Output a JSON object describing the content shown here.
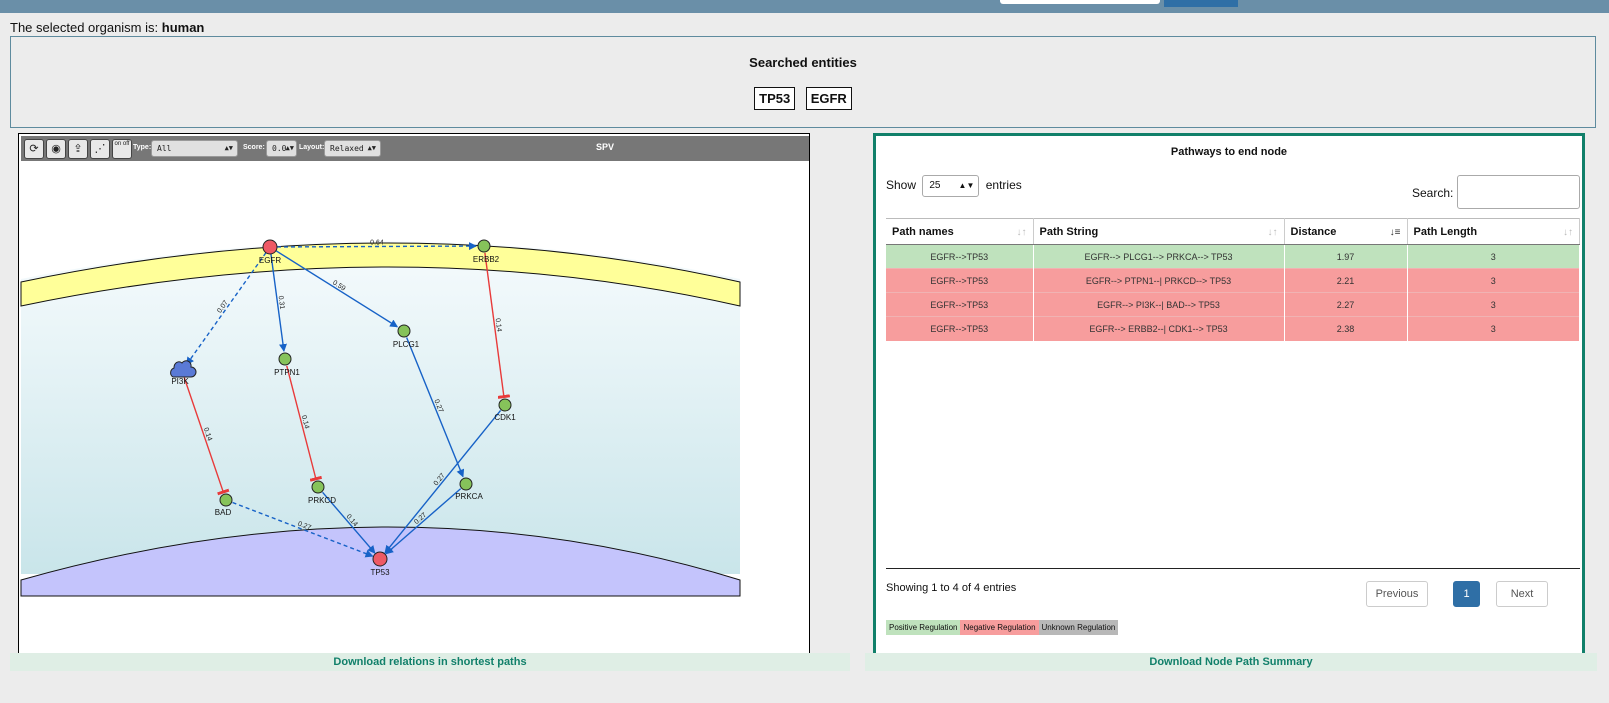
{
  "organism": {
    "prefix": "The selected organism is:",
    "name": "human"
  },
  "searched": {
    "title": "Searched entities",
    "entities": [
      "TP53",
      "EGFR"
    ]
  },
  "toolbar": {
    "type_label": "Type:",
    "type_value": "All",
    "score_label": "Score:",
    "score_value": "0.0",
    "layout_label": "Layout:",
    "layout_value": "Relaxed",
    "title": "SPV",
    "onoff": "on off"
  },
  "graph": {
    "colors": {
      "positive": "#1762c7",
      "negative": "#e83a3a",
      "node_green": "#86c35a",
      "node_red": "#ee5a65",
      "node_blue": "#5a7ad6"
    },
    "nodes": [
      {
        "id": "EGFR",
        "label": "EGFR",
        "color": "red"
      },
      {
        "id": "ERBB2",
        "label": "ERBB2",
        "color": "green"
      },
      {
        "id": "PI3K",
        "label": "PI3K",
        "color": "blue"
      },
      {
        "id": "PTPN1",
        "label": "PTPN1",
        "color": "green"
      },
      {
        "id": "PLCG1",
        "label": "PLCG1",
        "color": "green"
      },
      {
        "id": "CDK1",
        "label": "CDK1",
        "color": "green"
      },
      {
        "id": "BAD",
        "label": "BAD",
        "color": "green"
      },
      {
        "id": "PRKCD",
        "label": "PRKCD",
        "color": "green"
      },
      {
        "id": "PRKCA",
        "label": "PRKCA",
        "color": "green"
      },
      {
        "id": "TP53",
        "label": "TP53",
        "color": "red"
      }
    ],
    "edges": [
      {
        "from": "EGFR",
        "to": "ERBB2",
        "weight": "0.64",
        "type": "positive",
        "dashed": true
      },
      {
        "from": "EGFR",
        "to": "PI3K",
        "weight": "0.07",
        "type": "positive",
        "dashed": true
      },
      {
        "from": "EGFR",
        "to": "PTPN1",
        "weight": "0.31",
        "type": "positive",
        "dashed": false
      },
      {
        "from": "EGFR",
        "to": "PLCG1",
        "weight": "0.59",
        "type": "positive",
        "dashed": false
      },
      {
        "from": "ERBB2",
        "to": "CDK1",
        "weight": "0.14",
        "type": "negative",
        "dashed": false
      },
      {
        "from": "PI3K",
        "to": "BAD",
        "weight": "0.14",
        "type": "negative",
        "dashed": false
      },
      {
        "from": "PTPN1",
        "to": "PRKCD",
        "weight": "0.14",
        "type": "negative",
        "dashed": false
      },
      {
        "from": "PLCG1",
        "to": "PRKCA",
        "weight": "0.27",
        "type": "positive",
        "dashed": false
      },
      {
        "from": "CDK1",
        "to": "TP53",
        "weight": "0.27",
        "type": "positive",
        "dashed": false
      },
      {
        "from": "BAD",
        "to": "TP53",
        "weight": "0.27",
        "type": "positive",
        "dashed": true
      },
      {
        "from": "PRKCD",
        "to": "TP53",
        "weight": "0.14",
        "type": "positive",
        "dashed": false
      },
      {
        "from": "PRKCA",
        "to": "TP53",
        "weight": "0.27",
        "type": "positive",
        "dashed": false
      }
    ]
  },
  "table": {
    "title": "Pathways to end node",
    "show_label": "Show",
    "show_value": "25",
    "entries_label": "entries",
    "search_label": "Search:",
    "headers": [
      "Path names",
      "Path String",
      "Distance",
      "Path Length"
    ],
    "rows": [
      {
        "type": "pos",
        "cells": [
          "EGFR-->TP53",
          "EGFR--> PLCG1--> PRKCA--> TP53",
          "1.97",
          "3"
        ]
      },
      {
        "type": "neg",
        "cells": [
          "EGFR-->TP53",
          "EGFR--> PTPN1--| PRKCD--> TP53",
          "2.21",
          "3"
        ]
      },
      {
        "type": "neg",
        "cells": [
          "EGFR-->TP53",
          "EGFR--> PI3K--| BAD--> TP53",
          "2.27",
          "3"
        ]
      },
      {
        "type": "neg",
        "cells": [
          "EGFR-->TP53",
          "EGFR--> ERBB2--| CDK1--> TP53",
          "2.38",
          "3"
        ]
      }
    ],
    "info": "Showing 1 to 4 of 4 entries",
    "prev": "Previous",
    "page": "1",
    "next": "Next",
    "legend": {
      "positive": "Positive Regulation",
      "negative": "Negative Regulation",
      "unknown": "Unknown Regulation"
    }
  },
  "downloads": {
    "left": "Download relations in shortest paths",
    "right": "Download Node Path Summary"
  }
}
